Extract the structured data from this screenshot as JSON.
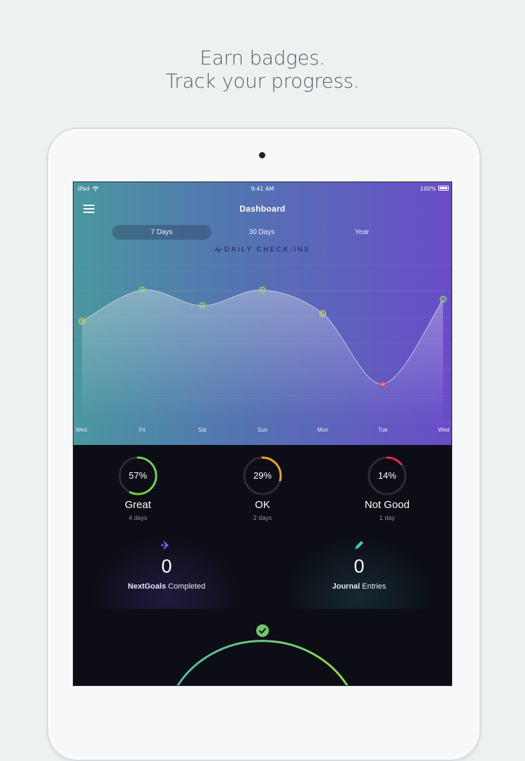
{
  "headline": {
    "line1": "Earn badges.",
    "line2": "Track your progress."
  },
  "status_bar": {
    "carrier": "iPad",
    "time": "9:41 AM",
    "battery": "100%"
  },
  "header": {
    "menu_icon": "hamburger-menu-icon",
    "title": "Dashboard"
  },
  "tabs": [
    {
      "label": "7 Days",
      "active": true
    },
    {
      "label": "30 Days",
      "active": false
    },
    {
      "label": "Year",
      "active": false
    }
  ],
  "chart_data": {
    "type": "line",
    "title": "DAILY CHECK-INS",
    "categories": [
      "Wed",
      "Fri",
      "Sat",
      "Sun",
      "Mon",
      "Tue",
      "Wed"
    ],
    "series": [
      {
        "values": [
          3.0,
          4.0,
          3.5,
          4.0,
          3.25,
          1.0,
          3.7
        ],
        "point_colors": [
          "#c9c93a",
          "#8bd14a",
          "#8bd14a",
          "#8bd14a",
          "#c9c93a",
          "#e0324f",
          "#8bd14a"
        ]
      }
    ],
    "ylim": [
      -0.2,
      4.8
    ],
    "grid": true,
    "fill_color": "#ffffff",
    "line_color": "#d7dcf3"
  },
  "moods": [
    {
      "percent_label": "57%",
      "percent": 57,
      "label": "Great",
      "days": "4 days",
      "color": "#6fd04b"
    },
    {
      "percent_label": "29%",
      "percent": 29,
      "label": "OK",
      "days": "2 days",
      "color": "#f0a32a"
    },
    {
      "percent_label": "14%",
      "percent": 14,
      "label": "Not Good",
      "days": "1 day",
      "color": "#e8294f"
    }
  ],
  "cards": {
    "goals": {
      "count": "0",
      "label_bold": "NextGoals",
      "label_rest": " Completed",
      "icon": "next-chevron-icon",
      "icon_color": "#8a5cf0"
    },
    "journal": {
      "count": "0",
      "label_bold": "Journal",
      "label_rest": " Entries",
      "icon": "pencil-icon",
      "icon_color": "#3fc7c2"
    }
  },
  "badge_arc": {
    "icon": "check-badge-icon"
  },
  "colors": {
    "ring_track": "#2a2d38",
    "arc_start": "#4fb6b0",
    "arc_end": "#8fd94e"
  }
}
